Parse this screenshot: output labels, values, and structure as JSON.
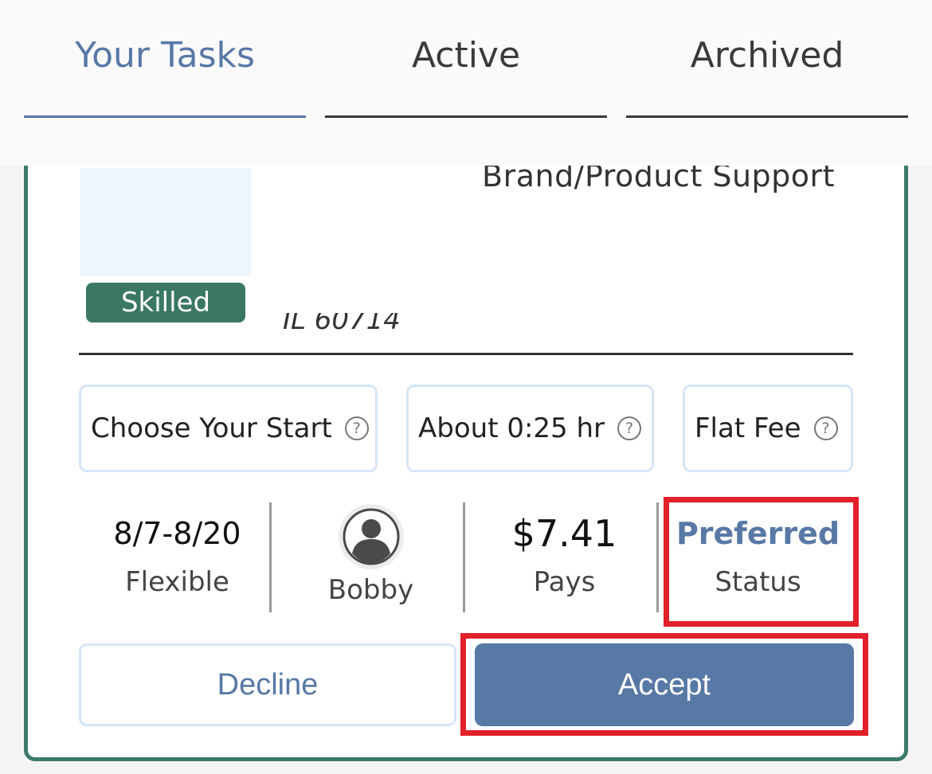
{
  "tabs": [
    {
      "label": "Your Tasks",
      "active": true
    },
    {
      "label": "Active",
      "active": false
    },
    {
      "label": "Archived",
      "active": false
    }
  ],
  "task": {
    "title": "Brand/Product Support",
    "skill_badge": "Skilled",
    "location": "IL 60714"
  },
  "chips": {
    "start": "Choose Your Start",
    "duration": "About 0:25 hr",
    "fee": "Flat Fee",
    "help_glyph": "?"
  },
  "stats": {
    "dates": {
      "value": "8/7-8/20",
      "sub": "Flexible"
    },
    "client": {
      "name": "Bobby"
    },
    "pay": {
      "value": "$7.41",
      "sub": "Pays"
    },
    "status": {
      "value": "Preferred",
      "sub": "Status"
    }
  },
  "actions": {
    "decline_label": "Decline",
    "accept_label": "Accept"
  },
  "colors": {
    "accent": "#5878a6",
    "card_border": "#3c7a6b",
    "badge": "#3a7765",
    "highlight": "#e1202a"
  }
}
